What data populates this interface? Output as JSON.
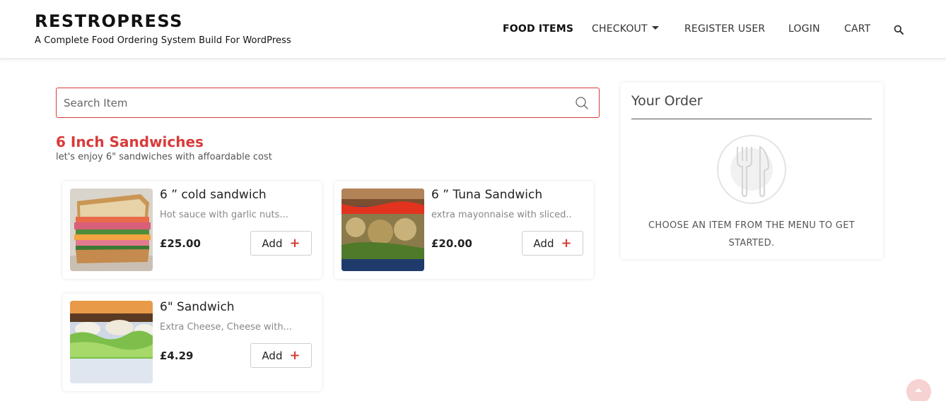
{
  "header": {
    "brand_title": "RESTROPRESS",
    "brand_tagline": "A Complete Food Ordering System Build For WordPress",
    "nav": [
      {
        "label": "FOOD ITEMS",
        "active": true
      },
      {
        "label": "CHECKOUT",
        "has_dropdown": true
      },
      {
        "label": "REGISTER USER"
      },
      {
        "label": "LOGIN"
      },
      {
        "label": "CART"
      }
    ],
    "search_icon": "search-icon"
  },
  "search": {
    "placeholder": "Search Item",
    "value": ""
  },
  "category": {
    "title": "6 Inch Sandwiches",
    "description": "let's enjoy 6\" sandwiches with affoardable cost"
  },
  "items": [
    {
      "name": "6 ” cold sandwich",
      "description": "Hot sauce with garlic nuts...",
      "price": "£25.00",
      "add_label": "Add"
    },
    {
      "name": "6 ” Tuna Sandwich",
      "description": "extra mayonnaise with sliced...",
      "price": "£20.00",
      "add_label": "Add"
    },
    {
      "name": "6\" Sandwich",
      "description": "Extra Cheese, Cheese with...",
      "price": "£4.29",
      "add_label": "Add"
    }
  ],
  "order": {
    "title": "Your Order",
    "empty_message": "CHOOSE AN ITEM FROM THE MENU TO GET STARTED.",
    "icon": "fork-knife-icon"
  },
  "colors": {
    "accent": "#d93a3a",
    "text": "#222222",
    "muted": "#888888"
  }
}
